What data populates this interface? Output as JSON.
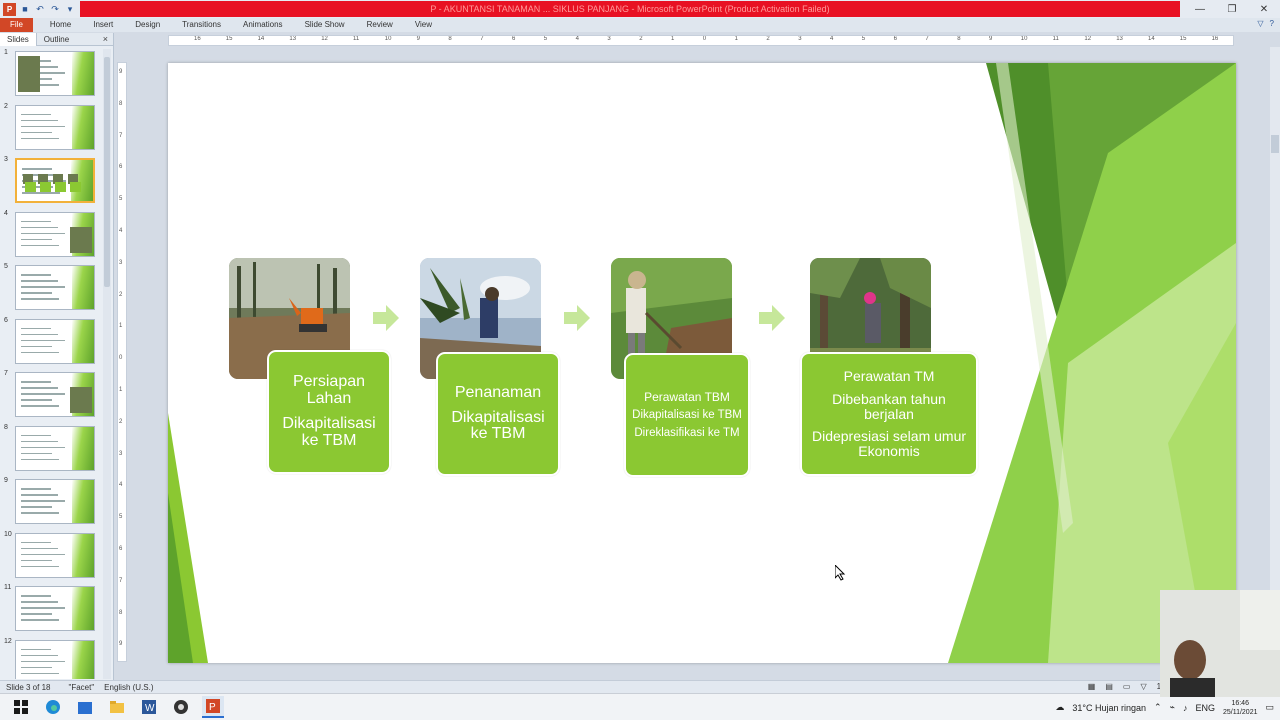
{
  "window": {
    "title": "P - AKUNTANSI TANAMAN ... SIKLUS PANJANG - Microsoft PowerPoint (Product Activation Failed)"
  },
  "ribbon": {
    "tabs": [
      "File",
      "Home",
      "Insert",
      "Design",
      "Transitions",
      "Animations",
      "Slide Show",
      "Review",
      "View"
    ]
  },
  "slides_pane": {
    "tabs": [
      "Slides",
      "Outline"
    ],
    "close": "×",
    "slide_numbers": [
      "1",
      "2",
      "3",
      "4",
      "5",
      "6",
      "7",
      "8",
      "9",
      "10",
      "11",
      "12"
    ],
    "selected": "3"
  },
  "ruler": {
    "h_ticks": [
      "16",
      "15",
      "14",
      "13",
      "12",
      "11",
      "10",
      "9",
      "8",
      "7",
      "6",
      "5",
      "4",
      "3",
      "2",
      "1",
      "0",
      "1",
      "2",
      "3",
      "4",
      "5",
      "6",
      "7",
      "8",
      "9",
      "10",
      "11",
      "12",
      "13",
      "14",
      "15",
      "16"
    ],
    "v_ticks": [
      "9",
      "8",
      "7",
      "6",
      "5",
      "4",
      "3",
      "2",
      "1",
      "0",
      "1",
      "2",
      "3",
      "4",
      "5",
      "6",
      "7",
      "8",
      "9"
    ]
  },
  "slide": {
    "steps": [
      {
        "title": "Persiapan Lahan",
        "detail": "Dikapitalisasi ke TBM"
      },
      {
        "title": "Penanaman",
        "detail": "Dikapitalisasi ke TBM"
      },
      {
        "title": "Perawatan TBM",
        "detail": "Dikapitalisasi ke TBM",
        "detail2": "Direklasifikasi ke TM"
      },
      {
        "title": "Perawatan TM",
        "detail": "Dibebankan tahun berjalan",
        "detail2": "Didepresiasi selam umur Ekonomis"
      }
    ],
    "accent": "#8bc832"
  },
  "statusbar": {
    "slide_info": "Slide 3 of 18",
    "theme": "\"Facet\"",
    "language": "English (U.S.)",
    "zoom": "125"
  },
  "taskbar": {
    "weather": "31°C  Hujan ringan",
    "lang": "ENG",
    "time": "16:46",
    "date": "25/11/2021"
  }
}
